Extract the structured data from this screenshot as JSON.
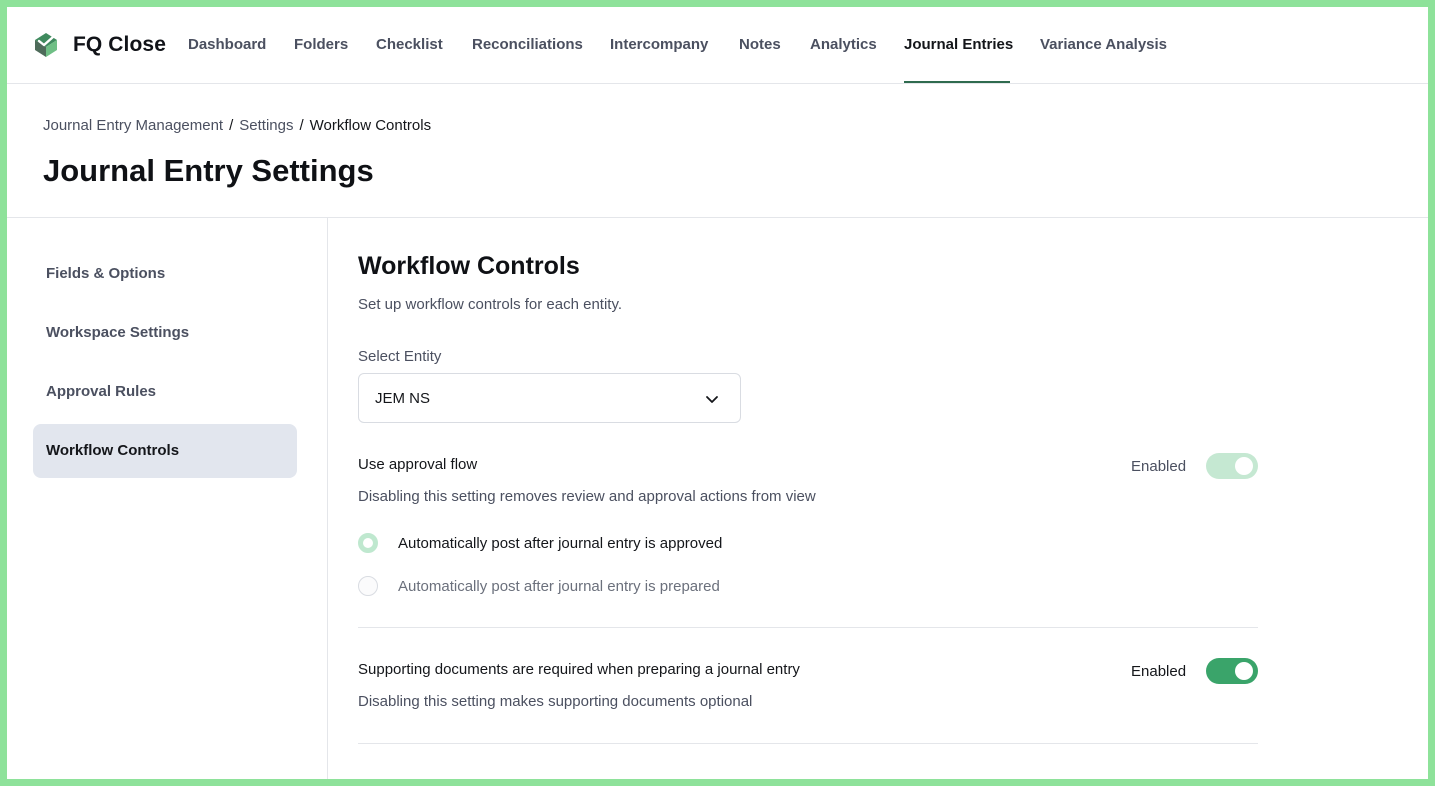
{
  "app": {
    "brand": "FQ Close"
  },
  "nav": {
    "items": [
      {
        "label": "Dashboard"
      },
      {
        "label": "Folders"
      },
      {
        "label": "Checklist"
      },
      {
        "label": "Reconciliations"
      },
      {
        "label": "Intercompany"
      },
      {
        "label": "Notes"
      },
      {
        "label": "Analytics"
      },
      {
        "label": "Journal Entries"
      },
      {
        "label": "Variance Analysis"
      }
    ],
    "active": "Journal Entries"
  },
  "breadcrumb": {
    "items": [
      {
        "label": "Journal Entry Management"
      },
      {
        "label": "Settings"
      },
      {
        "label": "Workflow Controls"
      }
    ],
    "separator": "/"
  },
  "page": {
    "title": "Journal Entry Settings"
  },
  "sidebar": {
    "items": [
      {
        "label": "Fields & Options"
      },
      {
        "label": "Workspace Settings"
      },
      {
        "label": "Approval Rules"
      },
      {
        "label": "Workflow Controls"
      }
    ],
    "active": "Workflow Controls"
  },
  "main": {
    "title": "Workflow Controls",
    "subtitle": "Set up workflow controls for each entity.",
    "entity": {
      "label": "Select Entity",
      "value": "JEM NS"
    },
    "approval_flow": {
      "title": "Use approval flow",
      "description": "Disabling this setting removes review and approval actions from view",
      "toggle_label": "Enabled",
      "enabled": true,
      "options": [
        {
          "label": "Automatically post after journal entry is approved",
          "selected": true
        },
        {
          "label": "Automatically post after journal entry is prepared",
          "selected": false
        }
      ]
    },
    "supporting_docs": {
      "title": "Supporting documents are required when preparing a journal entry",
      "description": "Disabling this setting makes supporting documents optional",
      "toggle_label": "Enabled",
      "enabled": true
    }
  },
  "colors": {
    "accent": "#3aa46a",
    "accent_light": "#c5e8d2",
    "nav_underline": "#2f6b4f",
    "frame": "#8ee29a",
    "sidebar_active": "#e2e6ee"
  },
  "icons": {
    "logo": "fq-close-logo-icon",
    "select_caret": "chevron-down-icon"
  }
}
